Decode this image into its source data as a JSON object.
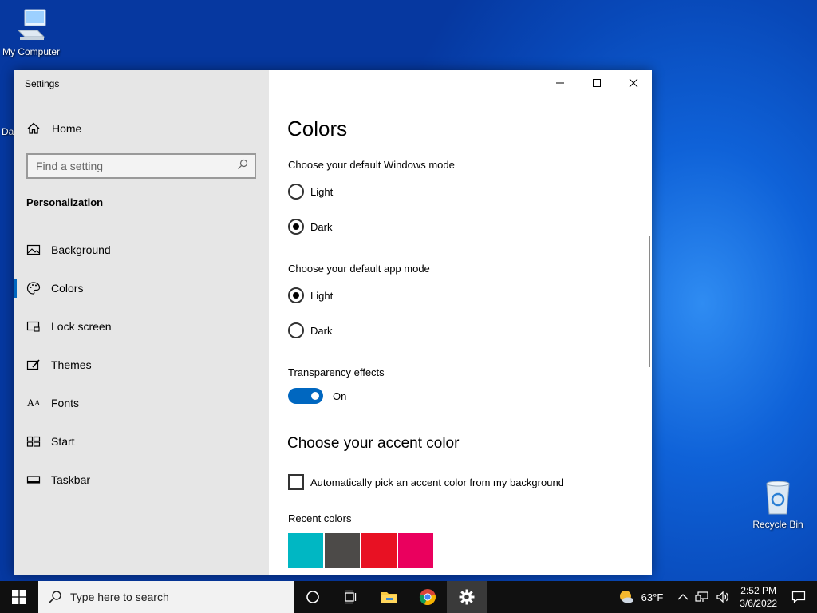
{
  "desktop": {
    "my_computer_label": "My Computer",
    "recycle_bin_label": "Recycle Bin"
  },
  "window": {
    "title": "Settings",
    "home_label": "Home",
    "search_placeholder": "Find a setting",
    "section_title": "Personalization",
    "nav_items": [
      {
        "label": "Background",
        "icon": "image-icon"
      },
      {
        "label": "Colors",
        "icon": "palette-icon",
        "active": true
      },
      {
        "label": "Lock screen",
        "icon": "lock-screen-icon"
      },
      {
        "label": "Themes",
        "icon": "themes-icon"
      },
      {
        "label": "Fonts",
        "icon": "fonts-icon"
      },
      {
        "label": "Start",
        "icon": "start-icon"
      },
      {
        "label": "Taskbar",
        "icon": "taskbar-icon"
      }
    ]
  },
  "content": {
    "title": "Colors",
    "windows_mode_label": "Choose your default Windows mode",
    "windows_mode_options": [
      {
        "label": "Light",
        "checked": false
      },
      {
        "label": "Dark",
        "checked": true
      }
    ],
    "app_mode_label": "Choose your default app mode",
    "app_mode_options": [
      {
        "label": "Light",
        "checked": true
      },
      {
        "label": "Dark",
        "checked": false
      }
    ],
    "transparency_label": "Transparency effects",
    "transparency_state": "On",
    "accent_heading": "Choose your accent color",
    "auto_pick_label": "Automatically pick an accent color from my background",
    "auto_pick_checked": false,
    "recent_colors_label": "Recent colors",
    "recent_colors": [
      "#00b7c3",
      "#4c4a48",
      "#e81123",
      "#ea005e"
    ]
  },
  "taskbar": {
    "search_placeholder": "Type here to search",
    "temperature": "63°F",
    "time": "2:52 PM",
    "date": "3/6/2022"
  },
  "colors": {
    "accent": "#0067c0",
    "sidebar_bg": "#e6e6e6",
    "taskbar_bg": "#101010"
  }
}
